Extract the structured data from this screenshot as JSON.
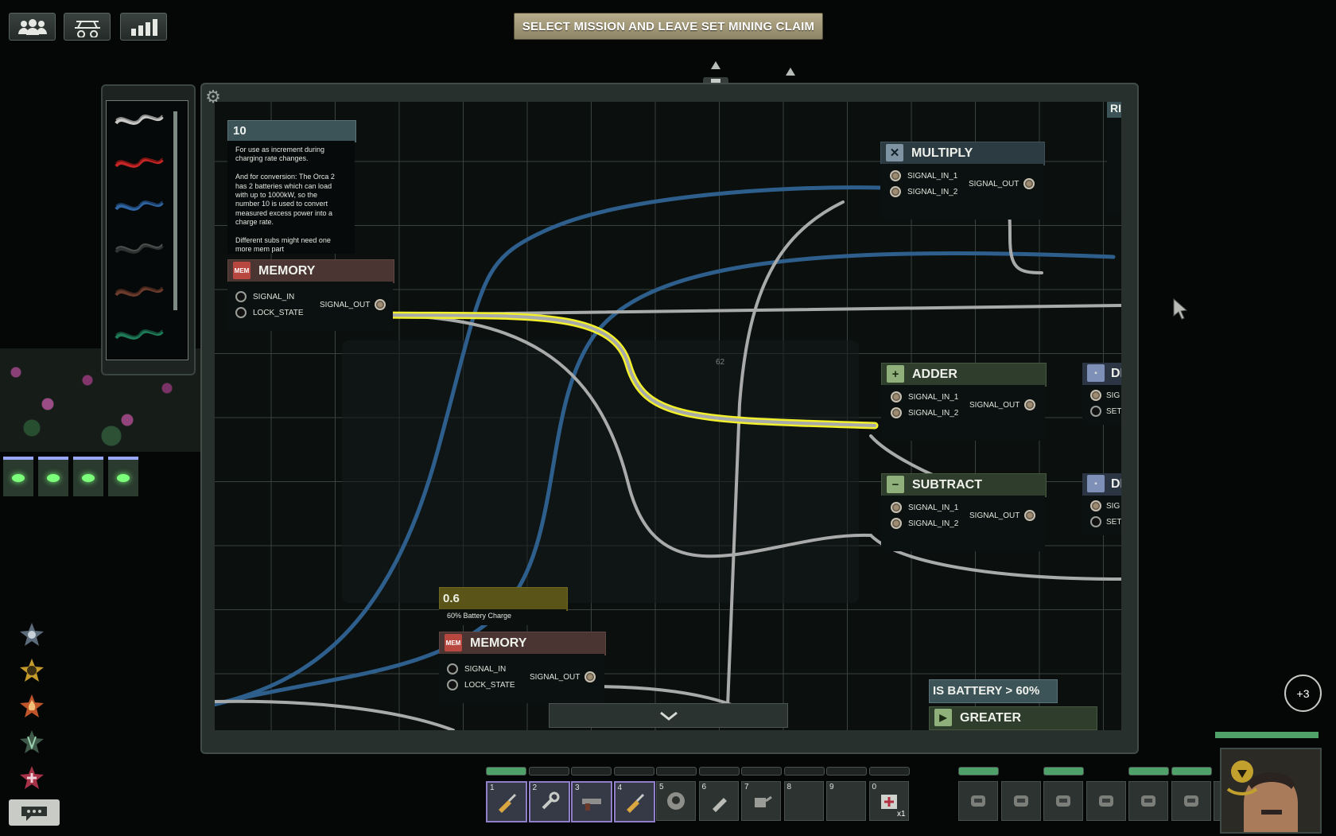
{
  "mission_button": "SELECT MISSION AND LEAVE SET MINING CLAIM",
  "top_icons": [
    "crew-icon",
    "submarine-icon",
    "stats-icon"
  ],
  "nodes": {
    "note_10": {
      "title": "10",
      "text": "For use as increment during\ncharging rate changes.\n\nAnd for conversion: The Orca 2\nhas 2 batteries which can load\nwith up to 1000kW, so the\nnumber 10 is used to convert\nmeasured excess power into a\ncharge rate.\n\nDifferent subs might need one\nmore mem part"
    },
    "memory_1": {
      "title": "MEMORY",
      "icon_label": "MEM",
      "in1": "SIGNAL_IN",
      "in2": "LOCK_STATE",
      "out": "SIGNAL_OUT"
    },
    "multiply": {
      "title": "MULTIPLY",
      "in1": "SIGNAL_IN_1",
      "in2": "SIGNAL_IN_2",
      "out": "SIGNAL_OUT"
    },
    "adder": {
      "title": "ADDER",
      "in1": "SIGNAL_IN_1",
      "in2": "SIGNAL_IN_2",
      "out": "SIGNAL_OUT"
    },
    "subtract": {
      "title": "SUBTRACT",
      "in1": "SIGNAL_IN_1",
      "in2": "SIGNAL_IN_2",
      "out": "SIGNAL_OUT"
    },
    "note_06": {
      "title": "0.6",
      "text": "60% Battery Charge"
    },
    "memory_2": {
      "title": "MEMORY",
      "icon_label": "MEM",
      "in1": "SIGNAL_IN",
      "in2": "LOCK_STATE",
      "out": "SIGNAL_OUT"
    },
    "battery_label": {
      "title": "IS BATTERY > 60%"
    },
    "greater": {
      "title": "GREATER"
    },
    "cut_right_top": {
      "title": "RI"
    },
    "cut_di_1": {
      "title": "DI",
      "in1": "SIG",
      "in2": "SET"
    },
    "cut_di_2": {
      "title": "DI",
      "in1": "SIG",
      "in2": "SET"
    }
  },
  "canvas_marker": "62",
  "hotbar": [
    {
      "num": "1",
      "icon": "screwdriver-icon",
      "selected": true
    },
    {
      "num": "2",
      "icon": "wrench-icon",
      "selected": true
    },
    {
      "num": "3",
      "icon": "gun-icon",
      "selected": true
    },
    {
      "num": "4",
      "icon": "screwdriver-icon",
      "selected": true
    },
    {
      "num": "5",
      "icon": "diving-mask-icon",
      "selected": false
    },
    {
      "num": "6",
      "icon": "flashlight-icon",
      "selected": false
    },
    {
      "num": "7",
      "icon": "watering-can-icon",
      "selected": false
    },
    {
      "num": "8",
      "icon": "",
      "selected": false
    },
    {
      "num": "9",
      "icon": "",
      "selected": false
    },
    {
      "num": "0",
      "icon": "medkit-icon",
      "selected": false,
      "count": "x1"
    }
  ],
  "equipment": [
    "smg-icon",
    "helmet-icon",
    "vest-icon",
    "headset-icon",
    "goggles-icon",
    "handcuffs-icon",
    "id-card-icon"
  ],
  "plus_badge": "+3",
  "side_icons": [
    "ship-icon",
    "gear-icon",
    "fire-icon",
    "hull-icon",
    "medical-icon"
  ],
  "colors": {
    "wire_blue": "#2e5f8c",
    "wire_gray": "#a9abaa",
    "wire_selected": "#f2ef2c"
  }
}
